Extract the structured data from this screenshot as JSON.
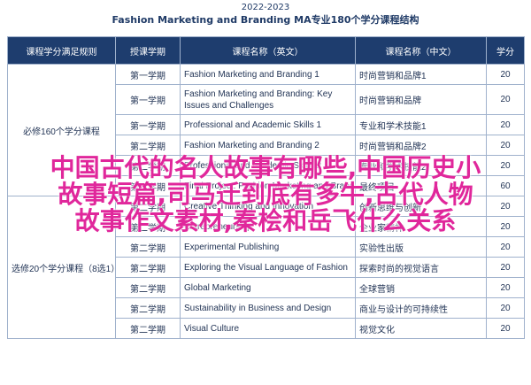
{
  "header": {
    "year": "2022-2023",
    "title": "Fashion Marketing and Branding MA专业180个学分课程结构"
  },
  "table": {
    "columns": [
      "课程学分满足规则",
      "授课学期",
      "课程名称（英文）",
      "课程名称（中文）",
      "学分"
    ],
    "groups": [
      {
        "label": "必修160个学分课程",
        "rows": [
          {
            "semester": "第一学期",
            "name_en": "Fashion Marketing and Branding 1",
            "name_cn": "时尚营销和品牌1",
            "credit": "20"
          },
          {
            "semester": "第一学期",
            "name_en": "Fashion Marketing and Branding: Key Issues and Challenges",
            "name_cn": "时尚营销和品牌",
            "credit": "20"
          },
          {
            "semester": "第一学期",
            "name_en": "Professional and Academic Skills 1",
            "name_cn": "专业和学术技能1",
            "credit": "20"
          },
          {
            "semester": "第二学期",
            "name_en": "Fashion Marketing and Branding 2",
            "name_cn": "时尚营销和品牌2",
            "credit": "20"
          },
          {
            "semester": "第二学期",
            "name_en": "Professional and Academic Skills 2",
            "name_cn": "专业和学术技能2",
            "credit": "20"
          },
          {
            "semester": "第三学期",
            "name_en": "Final Project: Fashion Marketing and Branding",
            "name_cn": "最终项目",
            "credit": "60"
          }
        ]
      },
      {
        "label": "选修20个学分课程（8选1）",
        "rows": [
          {
            "semester": "第二学期",
            "name_en": "Creative Thinking and Innovation",
            "name_cn": "创新思维与创新",
            "credit": "20"
          },
          {
            "semester": "第二学期",
            "name_en": "Entrepreneurship",
            "name_cn": "企业家精神",
            "credit": "20"
          },
          {
            "semester": "第二学期",
            "name_en": "Experimental Publishing",
            "name_cn": "实验性出版",
            "credit": "20"
          },
          {
            "semester": "第二学期",
            "name_en": "Exploring the Visual Language of Fashion",
            "name_cn": "探索时尚的视觉语言",
            "credit": "20"
          },
          {
            "semester": "第二学期",
            "name_en": "Global Marketing",
            "name_cn": "全球营销",
            "credit": "20"
          },
          {
            "semester": "第二学期",
            "name_en": "Sustainability in Business and Design",
            "name_cn": "商业与设计的可持续性",
            "credit": "20"
          },
          {
            "semester": "第二学期",
            "name_en": "Visual Culture",
            "name_cn": "视觉文化",
            "credit": "20"
          }
        ]
      }
    ]
  },
  "overlay": {
    "line1": "中国古代的名人故事有哪些,中国历史小",
    "line2": "故事短篇,司马迁到底有多牛,古代人物",
    "line3": "故事作文素材,秦桧和岳飞什么关系"
  }
}
